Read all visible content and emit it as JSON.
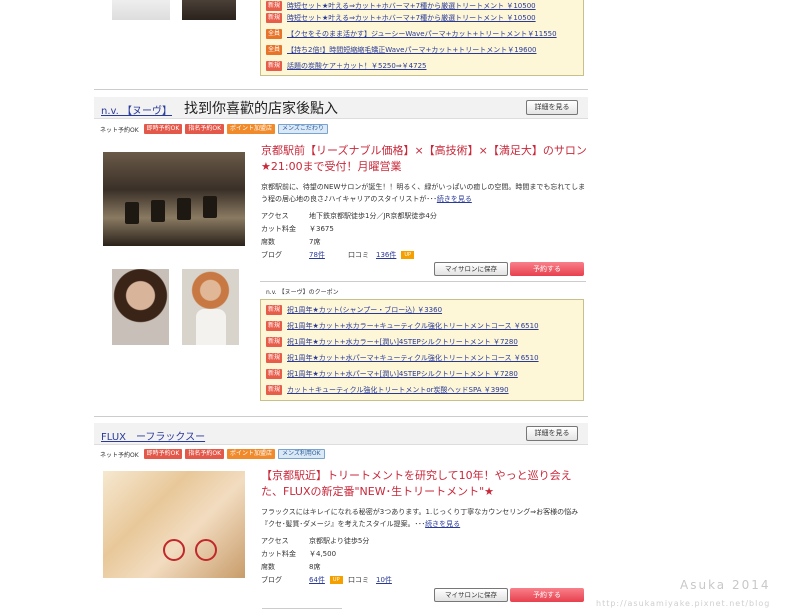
{
  "top_coupons": [
    {
      "badge": "新規",
      "text": "時短セット★叶える⇒カット+ホバーマ+7種から厳選トリートメント ￥10500"
    },
    {
      "badge": "新規",
      "text": "時短セット★叶える⇒カット+ホバーマ+7種から厳選トリートメント ￥10500"
    },
    {
      "badge": "全員",
      "text": "【クセをそのまま活かす】ジューシーWaveパーマ+カット+トリートメント￥11550"
    },
    {
      "badge": "全員",
      "text": "【持ち2倍!】時間短縮縮毛矯正Waveパーマ+カット+トリートメント￥19600"
    },
    {
      "badge": "新規",
      "text": "話題の炭酸ケア＋カット！￥5250⇒￥4725"
    }
  ],
  "salon1": {
    "name": "n.v. 【ヌーヴ】",
    "overlay_text": "找到你喜歡的店家後點入",
    "detail_btn": "詳細を見る",
    "tags": {
      "net": "ネット予約OK",
      "t1": "即時予約OK",
      "t2": "指名予約OK",
      "t3": "ポイント加盟店",
      "t4": "メンズこだわり"
    },
    "catch": "京都駅前【リーズナブル価格】×【高技術】×【満足大】のサロン★21:00まで受付！月曜営業",
    "desc": "京都駅前に、待望のNEWサロンが誕生！！明るく、緑がいっぱいの癒しの空間。時間までも忘れてしまう程の居心地の良さ♪ハイキャリアのスタイリストが･･･",
    "more": "続きを見る",
    "access_k": "アクセス",
    "access_v": "地下鉄京都駅徒歩1分／JR京都駅徒歩4分",
    "cut_k": "カット料金",
    "cut_v": "￥3675",
    "seat_k": "席数",
    "seat_v": "7席",
    "blog_k": "ブログ",
    "blog_v": "78件",
    "review_k": "口コミ",
    "review_v": "136件",
    "up": "UP",
    "save": "マイサロンに保存",
    "reserve": "予約する",
    "coupon_label": "n.v. 【ヌーヴ】のクーポン",
    "coupons": [
      {
        "badge": "新規",
        "text": "祝1周年★カット(シャンプー・ブロー込) ￥3360"
      },
      {
        "badge": "新規",
        "text": "祝1周年★カット+水カラー+キューティクル強化トリートメントコース ￥6510"
      },
      {
        "badge": "新規",
        "text": "祝1周年★カット+水カラー+[潤い]4STEPシルクトリートメント ￥7280"
      },
      {
        "badge": "新規",
        "text": "祝1周年★カット+水パーマ+キューティクル強化トリートメントコース ￥6510"
      },
      {
        "badge": "新規",
        "text": "祝1周年★カット+水パーマ+[潤い]4STEPシルクトリートメント ￥7280"
      },
      {
        "badge": "新規",
        "text": "カット＋キューティクル強化トリートメントor炭酸ヘッドSPA ￥3990"
      }
    ]
  },
  "salon2": {
    "name": "FLUX　ーフラックスー",
    "detail_btn": "詳細を見る",
    "tags": {
      "net": "ネット予約OK",
      "t1": "即時予約OK",
      "t2": "指名予約OK",
      "t3": "ポイント加盟店",
      "t4": "メンズ利用OK"
    },
    "catch": "【京都駅近】トリートメントを研究して10年！やっと巡り会えた、FLUXの新定番\"NEW･生トリートメント\"★",
    "desc": "フラックスにはキレイになれる秘密が3つあります。1.じっくり丁寧なカウンセリング⇒お客様の悩み『クセ･髪質･ダメージ』を考えたスタイル提案。･･･",
    "more": "続きを見る",
    "access_k": "アクセス",
    "access_v": "京都駅より徒歩5分",
    "cut_k": "カット料金",
    "cut_v": "￥4,500",
    "seat_k": "席数",
    "seat_v": "8席",
    "blog_k": "ブログ",
    "blog_v": "64件",
    "review_k": "口コミ",
    "review_v": "10件",
    "up": "UP",
    "save": "マイサロンに保存",
    "reserve": "予約する"
  },
  "watermark": {
    "line1": "Asuka 2014",
    "line2": "http://asukamiyake.pixnet.net/blog"
  }
}
